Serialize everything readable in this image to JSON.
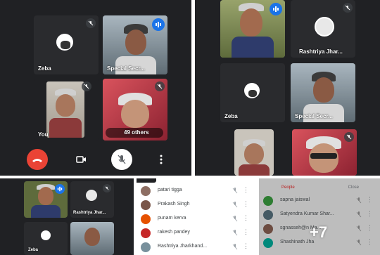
{
  "meeting1": {
    "tiles": [
      {
        "name": "Zeba"
      },
      {
        "name": "Special Secr..."
      },
      {
        "name": "You"
      },
      {
        "name": "49 others"
      }
    ],
    "controls": [
      "end-call",
      "camera",
      "mic-off",
      "more"
    ]
  },
  "meeting2": {
    "tiles": [
      {
        "name": ""
      },
      {
        "name": "Rashtriya Jhar..."
      },
      {
        "name": "Zeba"
      },
      {
        "name": "Special Secr..."
      },
      {
        "name": ""
      },
      {
        "name": ""
      }
    ]
  },
  "meeting3": {
    "tiles": [
      {
        "name": "Rashtriya Jhar..."
      },
      {
        "name": "Zeba"
      }
    ]
  },
  "people_list": [
    {
      "name": "patari tigga",
      "color": "#8d6e63"
    },
    {
      "name": "Prakash Singh",
      "color": "#795548"
    },
    {
      "name": "punam kerva",
      "color": "#e65100"
    },
    {
      "name": "rakesh pandey",
      "color": "#c62828"
    },
    {
      "name": "Rashtriya Jharkhand...",
      "color": "#78909c"
    }
  ],
  "people_list_grey": {
    "header_left": "People",
    "header_right": "Close",
    "overlay_count": "+7",
    "items": [
      {
        "name": "sapna jaiswal",
        "color": "#2e7d32"
      },
      {
        "name": "Satyendra Kumar Shar...",
        "color": "#455a64"
      },
      {
        "name": "sgnasseh@n Ma...",
        "color": "#6d4c41"
      },
      {
        "name": "Shashinath Jha",
        "color": "#00897b"
      }
    ]
  }
}
